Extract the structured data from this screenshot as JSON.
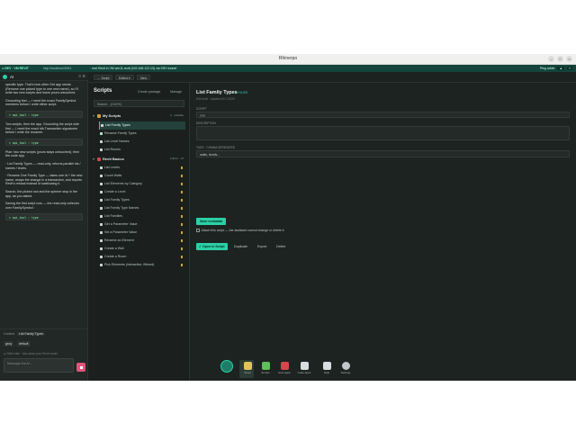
{
  "window": {
    "title": "Rhinerpo",
    "controls": [
      "–",
      "□",
      "×"
    ]
  },
  "devbar": {
    "badge": "● DEV · VM REVIT",
    "url": "http://localhost:5051",
    "desc": "· real Revit in VM win11-revit (192.168.122.13) via SSH tunnel",
    "ping": "Ping addin",
    "buttons": [
      "▲",
      "×"
    ]
  },
  "ai_panel": {
    "label": "AI",
    "controls": "⊙ ⚙",
    "messages": [
      "specific type. That's how other Get app needs (Rename one picked type to one new name), so I'll write two new scripts and leave yours untouched.",
      "Grounding first — I need the exact FamilySymbol members before I write either script.",
      "Two scripts, then the app. Grounding the script side first — I need the exact idb.Transaction signatures before I write the renamer.",
      "Plan: two new scripts (yours stays untouched), then the code app."
    ],
    "code_lines": [
      "> api_tool ›  type",
      "> api_tool ›  type",
      "> api_tool ›  type"
    ],
    "list_intro": "· List Family Types — read-only, returns parallel ids / names / levels.",
    "list_second": "· Rename One Family Type — takes one id + the new name, wraps the change in a transaction, and reports Revit's refusal instead of swallowing it.",
    "closing": "Search, the picked row and the spinner stop in the app, as you asked.",
    "saving": "Saving the first script now — the read-only collector over FamilySymbol :",
    "context_label": "Context",
    "context_chip": "List Family Types",
    "model_select": "groq",
    "profile_select": "default",
    "hint": "⊕ Shift-enter · Ask about your Revit model",
    "input_placeholder": "Message the AI..."
  },
  "toolbar": {
    "buttons": [
      "← Script",
      "Edited ▾",
      "New"
    ]
  },
  "scripts_panel": {
    "title": "Scripts",
    "create_label": "Create package",
    "manage_label": "Manage",
    "search_placeholder": "Search... (Ctrl+K)",
    "groups": [
      {
        "name": "My Scripts",
        "tag": "3 · editable",
        "color": "gold",
        "items": [
          "List Family Types",
          "Rename Family Types",
          "List Level Names",
          "List Rooms"
        ]
      },
      {
        "name": "Revit Basics",
        "tag": "built-in · 12",
        "color": "red",
        "items": [
          "List Levels",
          "Count Walls",
          "List Elements by Category",
          "Create a Level",
          "List Family Types",
          "List Family Type Names",
          "List Families",
          "Get a Parameter Value",
          "Set a Parameter Value",
          "Rename an Element",
          "Create a Wall",
          "Create a Room",
          "Pick Elements (interactive, filtered)"
        ]
      }
    ]
  },
  "editor": {
    "title": "List Family Types",
    "badge": "● YOURS",
    "subtitle": "Edit draft · Updated 6/17/2026",
    "name_label": "SCRIPT",
    "name_value": "???",
    "desc_label": "DESCRIPTION",
    "desc_value": "",
    "tags_label": "TAGS · COMMA SEPARATED",
    "tags_value": "walls, levels...",
    "save_label": "Save metadata",
    "lock_label": "Attach this script — the assistant cannot change or delete it",
    "actions": [
      "✓ Open in Script",
      "Duplicate",
      "Export",
      "Delete"
    ]
  },
  "dock": {
    "items": [
      {
        "label": "Script",
        "color": "#e2c35a"
      },
      {
        "label": "Scripts",
        "color": "#5fbf5a"
      },
      {
        "label": "Host Apps",
        "color": "#d4474a"
      },
      {
        "label": "Code Apps",
        "color": "#d8dde0"
      },
      {
        "label": "Help",
        "color": "#d8dde0"
      },
      {
        "label": "Settings",
        "color": "#c0c8cc"
      }
    ]
  }
}
